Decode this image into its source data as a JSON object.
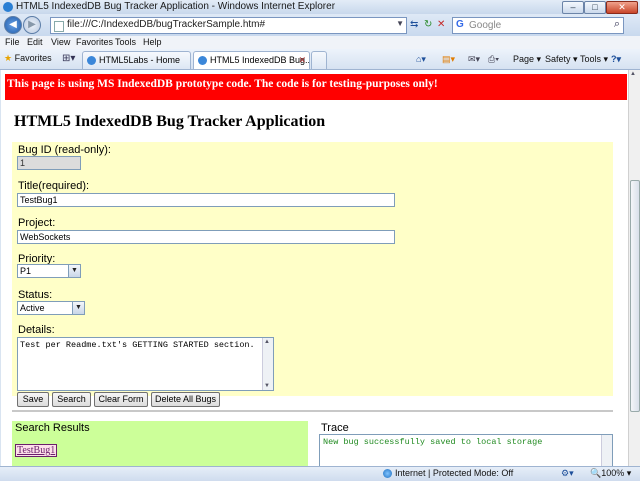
{
  "window": {
    "title": "HTML5 IndexedDB Bug Tracker Application - Windows Internet Explorer"
  },
  "addressbar": {
    "url": "file:///C:/IndexedDB/bugTrackerSample.htm#",
    "search_placeholder": "Google"
  },
  "menu": [
    "File",
    "Edit",
    "View",
    "Favorites",
    "Tools",
    "Help"
  ],
  "commandbar": {
    "favorites_label": "Favorites",
    "tabs": [
      {
        "label": "HTML5Labs - Home"
      },
      {
        "label": "HTML5 IndexedDB Bug..."
      }
    ],
    "page_label": "Page",
    "safety_label": "Safety",
    "tools_label": "Tools"
  },
  "page": {
    "banner": "This page is using MS IndexedDB prototype code. The code is for testing-purposes only!",
    "title": "HTML5 IndexedDB Bug Tracker Application",
    "form": {
      "bug_id_label": "Bug ID (read-only):",
      "bug_id_value": "1",
      "title_label": "Title(required):",
      "title_value": "TestBug1",
      "project_label": "Project:",
      "project_value": "WebSockets",
      "priority_label": "Priority:",
      "priority_value": "P1",
      "status_label": "Status:",
      "status_value": "Active",
      "details_label": "Details:",
      "details_value": "Test per Readme.txt's GETTING STARTED section.",
      "buttons": {
        "save": "Save",
        "search": "Search",
        "clear": "Clear Form",
        "delete_all": "Delete All Bugs"
      }
    },
    "results": {
      "header": "Search Results",
      "items": [
        "TestBug1"
      ]
    },
    "trace": {
      "header": "Trace",
      "text": "New bug successfully saved to local storage"
    }
  },
  "statusbar": {
    "zone": "Internet | Protected Mode: Off",
    "zoom": "100%"
  }
}
